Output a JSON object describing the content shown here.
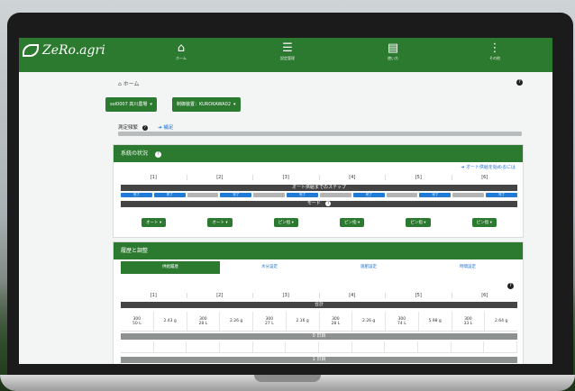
{
  "nav": {
    "brand": "ZeRo.agri",
    "items": [
      {
        "icon": "home-icon",
        "glyph": "⌂",
        "label": "ホーム"
      },
      {
        "icon": "sliders-icon",
        "glyph": "☰",
        "label": "設定管理"
      },
      {
        "icon": "book-icon",
        "glyph": "▤",
        "label": "使い方"
      },
      {
        "icon": "more-vertical-icon",
        "glyph": "⋮",
        "label": "その他"
      }
    ]
  },
  "breadcrumb": "ホーム",
  "help_glyph": "?",
  "selectors": {
    "farm": "sol0007 高川農場",
    "area": "制御装置：KUROKAWA02"
  },
  "progress": {
    "label": "測定頻繁",
    "link": "補足",
    "value": 1.0
  },
  "irrigation_status": {
    "title": "系統の状況",
    "link": "オート供給を始めるには",
    "columns": [
      "[1]",
      "[2]",
      "[3]",
      "[4]",
      "[5]",
      "[6]"
    ],
    "steps_header": "オート供給までのステップ",
    "steps": [
      {
        "text": "完了",
        "color": "#1f7bd6"
      },
      {
        "text": "完了",
        "color": "#1f7bd6"
      },
      {
        "text": "",
        "color": "#b4b4b4"
      },
      {
        "text": "完了",
        "color": "#1f7bd6"
      },
      {
        "text": "",
        "color": "#b4b4b4"
      },
      {
        "text": "完了",
        "color": "#1f7bd6"
      },
      {
        "text": "",
        "color": "#b4b4b4"
      },
      {
        "text": "完了",
        "color": "#1f7bd6"
      },
      {
        "text": "",
        "color": "#b4b4b4"
      },
      {
        "text": "完了",
        "color": "#1f7bd6"
      },
      {
        "text": "",
        "color": "#b4b4b4"
      },
      {
        "text": "完了",
        "color": "#1f7bd6"
      }
    ],
    "mode_header": "モード",
    "modes": [
      "オート",
      "オート",
      "ピン指",
      "ピン指",
      "ピン指",
      "ピン指"
    ]
  },
  "records": {
    "title": "履歴と調整",
    "tabs": [
      "供給履歴",
      "水分設定",
      "施肥設定",
      "時間設定"
    ],
    "columns": [
      "[1]",
      "[2]",
      "[3]",
      "[4]",
      "[5]",
      "[6]"
    ],
    "total_header": "合計",
    "totals": [
      {
        "vol": "300\n50 L",
        "fert": "2.43 g"
      },
      {
        "vol": "300\n28 L",
        "fert": "2.26 g"
      },
      {
        "vol": "300\n27 L",
        "fert": "2.16 g"
      },
      {
        "vol": "300\n28 L",
        "fert": "2.26 g"
      },
      {
        "vol": "300\n74 L",
        "fert": "5.98 g"
      },
      {
        "vol": "300\n33 L",
        "fert": "2.64 g"
      }
    ],
    "day0_header": "0 日目",
    "day1_header": "1 日目"
  },
  "colors": {
    "brand_green": "#2b7a2f",
    "link_blue": "#1f6fd1",
    "step_blue": "#1f7bd6"
  }
}
